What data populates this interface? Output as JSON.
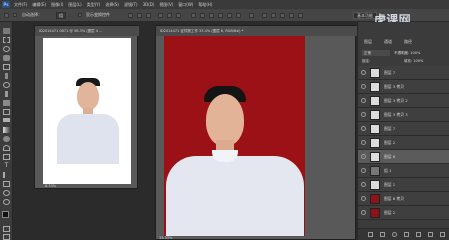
{
  "app": {
    "logo": "Ps"
  },
  "menu": [
    "文件(F)",
    "编辑(E)",
    "图像(I)",
    "图层(L)",
    "类型(Y)",
    "选择(S)",
    "滤镜(T)",
    "3D(D)",
    "视图(V)",
    "窗口(W)",
    "帮助(H)"
  ],
  "options": {
    "auto_select": "自动选择：",
    "group": "组",
    "show_transform": "显示变换控件",
    "workspace": "基本功能"
  },
  "doc1": {
    "tab": "ID2014471 0871 @ 58.3% (图层 4 ...",
    "zoom": "8.33%"
  },
  "doc2": {
    "tab": "ID2014471 证件照工作 33.4% (图层 6, RGB/8#) *",
    "zoom": "33.33%"
  },
  "panel": {
    "tabs": [
      "图层",
      "通道",
      "路径"
    ],
    "kind": "正常",
    "opacity": "不透明度: 100%",
    "lock": "锁定:",
    "fill": "填充: 100%",
    "layers": [
      {
        "name": "图层 7",
        "active": false
      },
      {
        "name": "图层 3 拷贝",
        "active": false
      },
      {
        "name": "图层 3 拷贝 2",
        "active": false
      },
      {
        "name": "图层 3 拷贝 3",
        "active": false
      },
      {
        "name": "图层 7",
        "active": false
      },
      {
        "name": "图层 2",
        "active": false
      },
      {
        "name": "图层 6",
        "active": true
      },
      {
        "name": "组 1",
        "active": false
      },
      {
        "name": "图层 1",
        "active": false
      },
      {
        "name": "图层 8 拷贝",
        "active": false
      },
      {
        "name": "图层 2",
        "active": false
      }
    ]
  },
  "watermark": "虎课网"
}
